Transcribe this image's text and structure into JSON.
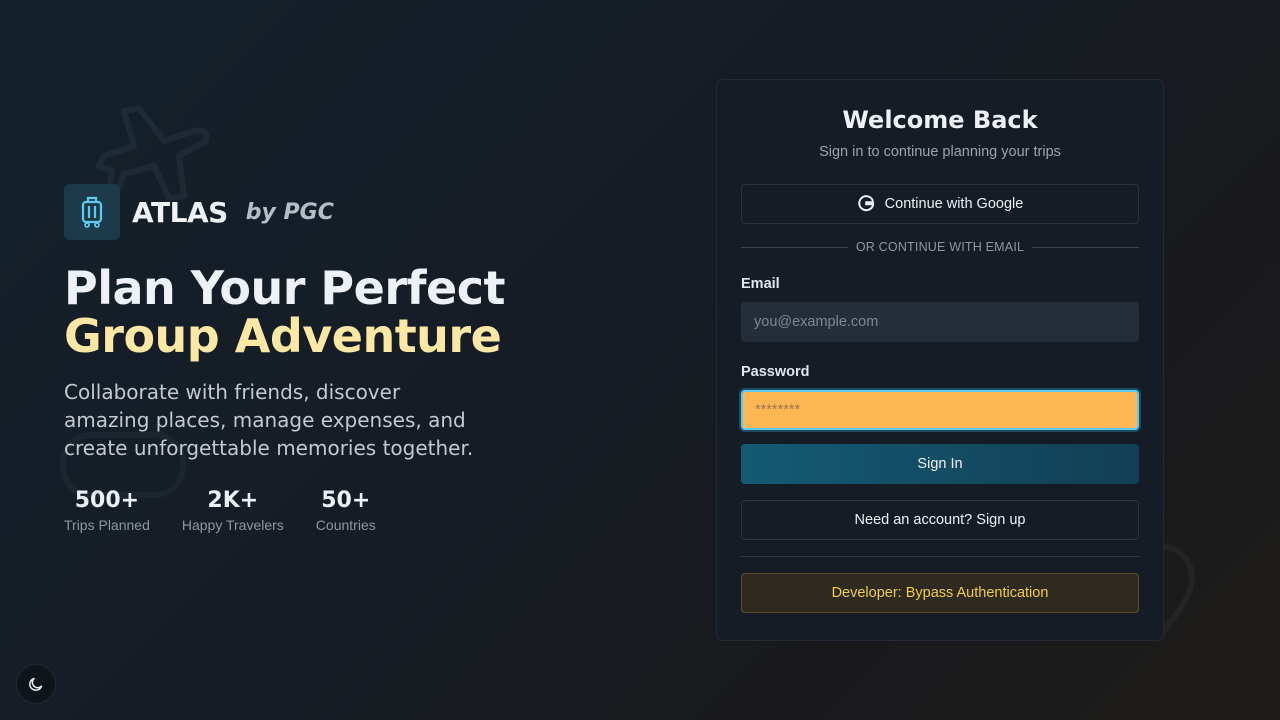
{
  "brand": {
    "name": "ATLAS",
    "by": "by PGC",
    "logo_icon": "suitcase-icon"
  },
  "hero": {
    "headline_line1": "Plan Your Perfect",
    "headline_line2": "Group Adventure",
    "subtitle": "Collaborate with friends, discover amazing places, manage expenses, and create unforgettable memories together.",
    "stats": [
      {
        "value": "500+",
        "label": "Trips Planned"
      },
      {
        "value": "2K+",
        "label": "Happy Travelers"
      },
      {
        "value": "50+",
        "label": "Countries"
      }
    ]
  },
  "card": {
    "title": "Welcome Back",
    "subtitle": "Sign in to continue planning your trips",
    "google_button": "Continue with Google",
    "divider": "OR CONTINUE WITH EMAIL",
    "email_label": "Email",
    "email_placeholder": "you@example.com",
    "password_label": "Password",
    "password_placeholder": "********",
    "signin_button": "Sign In",
    "signup_button": "Need an account? Sign up",
    "dev_button": "Developer: Bypass Authentication"
  },
  "theme_toggle": {
    "icon": "moon-icon"
  },
  "colors": {
    "accent_yellow": "#fde7a4",
    "primary_button": "#145a73",
    "password_field": "#ffb655",
    "dev_text": "#f0cc4a"
  }
}
